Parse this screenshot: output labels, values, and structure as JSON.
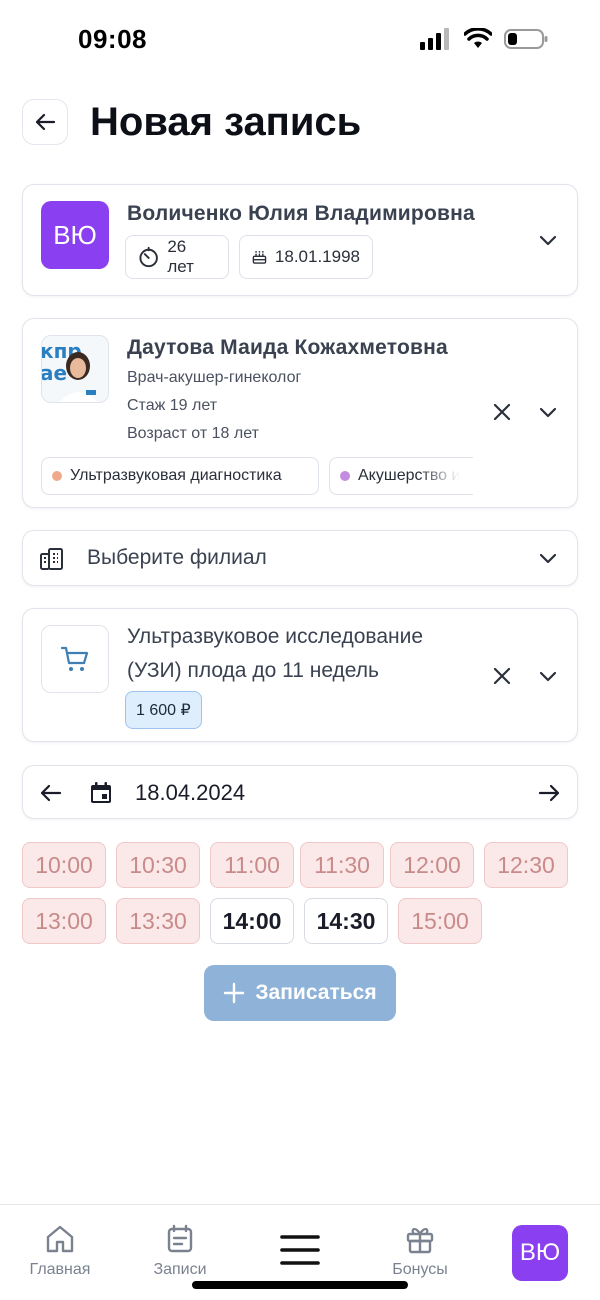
{
  "status_bar": {
    "time": "09:08"
  },
  "header": {
    "title": "Новая запись"
  },
  "patient": {
    "initials": "ВЮ",
    "name": "Воличенко Юлия Владимировна",
    "age": "26 лет",
    "birthdate": "18.01.1998"
  },
  "doctor": {
    "name": "Даутова Маида Кожахметовна",
    "specialty": "Врач-акушер-гинеколог",
    "experience": "Стаж 19 лет",
    "age_limit": "Возраст от 18 лет",
    "tags": [
      {
        "label": "Ультразвуковая диагностика",
        "color": "#f0a98a"
      },
      {
        "label": "Акушерство и",
        "color": "#c48be0"
      }
    ]
  },
  "branch": {
    "placeholder": "Выберите филиал"
  },
  "service": {
    "name_line1": "Ультразвуковое исследование",
    "name_line2": "(УЗИ) плода до 11 недель",
    "price": "1 600 ₽"
  },
  "date_picker": {
    "date": "18.04.2024"
  },
  "slots": [
    {
      "time": "10:00",
      "status": "busy"
    },
    {
      "time": "10:30",
      "status": "busy"
    },
    {
      "time": "11:00",
      "status": "busy"
    },
    {
      "time": "11:30",
      "status": "busy"
    },
    {
      "time": "12:00",
      "status": "busy"
    },
    {
      "time": "12:30",
      "status": "busy"
    },
    {
      "time": "13:00",
      "status": "busy"
    },
    {
      "time": "13:30",
      "status": "busy"
    },
    {
      "time": "14:00",
      "status": "free"
    },
    {
      "time": "14:30",
      "status": "free"
    },
    {
      "time": "15:00",
      "status": "busy"
    }
  ],
  "submit": {
    "label": "Записаться"
  },
  "tabbar": {
    "home": "Главная",
    "appointments": "Записи",
    "bonuses": "Бонусы",
    "profile_initials": "ВЮ"
  },
  "colors": {
    "accent_purple": "#8a3ff0",
    "busy_slot_bg": "#fbe8e8",
    "submit_bg": "#8fb3d8",
    "price_bg": "#dfeefc"
  }
}
